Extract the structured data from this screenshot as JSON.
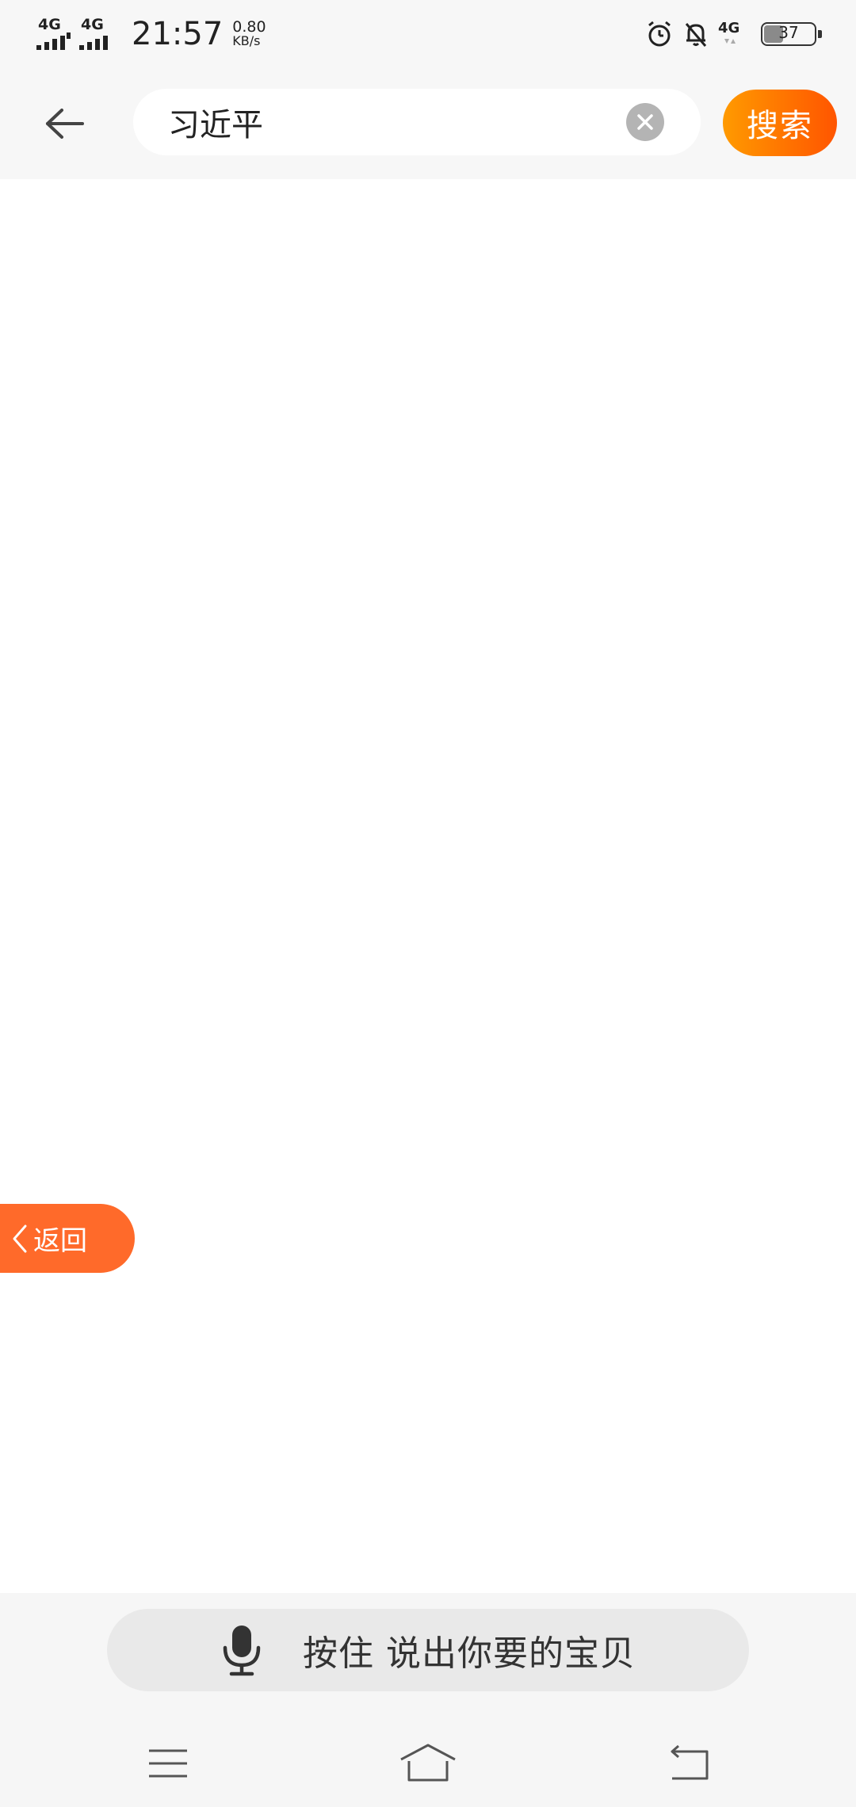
{
  "status_bar": {
    "sim1_network": "4G",
    "sim2_network": "4G",
    "time": "21:57",
    "speed_value": "0.80",
    "speed_unit": "KB/s",
    "right_network": "4G",
    "battery": "37",
    "icons": [
      "alarm-icon",
      "bell-muted-icon",
      "signal-icon",
      "battery-icon"
    ]
  },
  "header": {
    "back_icon": "arrow-left-icon",
    "search_value": "习近平",
    "clear_icon": "close-circle-icon",
    "search_button": "搜索"
  },
  "floating_back": {
    "label": "返回",
    "icon": "chevron-left-icon"
  },
  "voice": {
    "label": "按住 说出你要的宝贝",
    "icon": "microphone-icon"
  },
  "nav": {
    "icons": [
      "menu-icon",
      "home-icon",
      "back-icon"
    ]
  },
  "colors": {
    "accent_start": "#ff9a00",
    "accent_end": "#ff5500",
    "float_back": "#ff6a2a",
    "header_bg": "#f7f7f7",
    "voice_bg": "#e9e9e9"
  }
}
